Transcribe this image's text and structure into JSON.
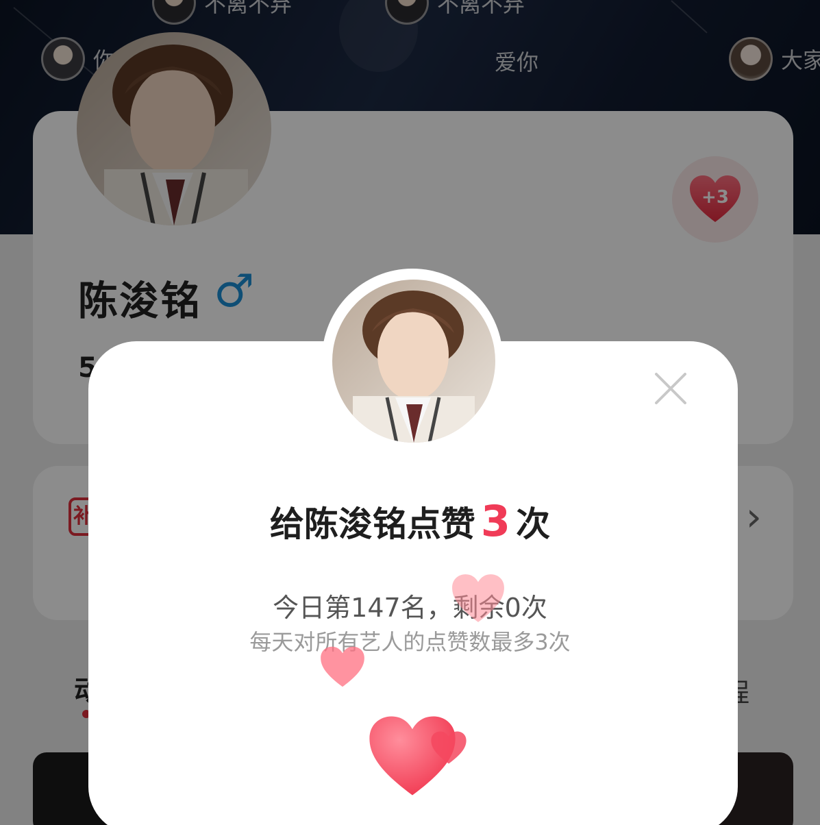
{
  "danmaku": [
    {
      "avatar": "user-avatar-1",
      "text": "不离不弃"
    },
    {
      "avatar": "user-avatar-2",
      "text": "不离不弃"
    },
    {
      "avatar": "user-avatar-3",
      "text": "你"
    },
    {
      "avatar": "",
      "text": "爱你"
    },
    {
      "avatar": "user-avatar-4",
      "text": "大家"
    }
  ],
  "profile": {
    "name": "陈浚铭",
    "gender_icon": "male-icon",
    "gender_glyph": "♂",
    "stat_partial": "5",
    "like_badge": "+3"
  },
  "sign_card": {
    "tag_text": "补",
    "arrow": "chevron-right-icon"
  },
  "tabs": {
    "left_partial": "动",
    "right_partial": "程"
  },
  "modal": {
    "title_prefix": "给陈浚铭点赞",
    "count": "3",
    "title_suffix": "次",
    "rank_text": "今日第147名，剩余0次",
    "limit_text": "每天对所有艺人的点赞数最多3次",
    "close_icon": "close-icon"
  },
  "colors": {
    "accent": "#f03b57",
    "gender": "#1c8fd6",
    "heart": "#f7485e"
  }
}
